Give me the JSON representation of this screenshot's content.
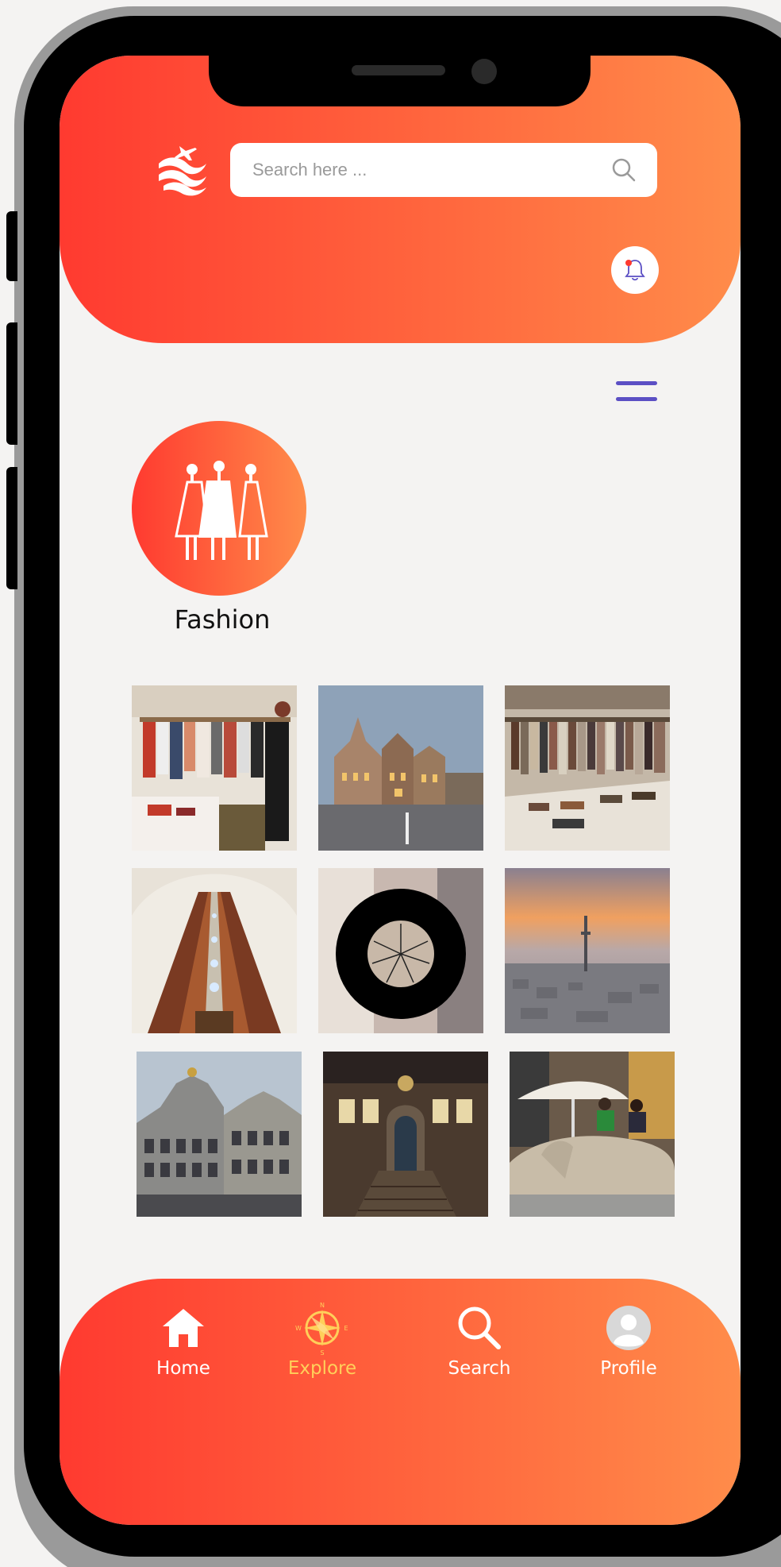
{
  "app": {
    "brand_colors": {
      "gradient_start": "#ff3a30",
      "gradient_end": "#ff8c4a",
      "accent_purple": "#5b4fc4",
      "active_nav": "#ffcf5a"
    }
  },
  "header": {
    "logo_icon": "wave-airplane-logo-icon",
    "search": {
      "placeholder": "Search here ...",
      "value": "",
      "icon": "search-icon"
    },
    "notification_icon": "bell-icon"
  },
  "menu_icon": "hamburger-menu-icon",
  "category": {
    "icon": "mannequins-icon",
    "label": "Fashion"
  },
  "gallery": {
    "items": [
      {
        "subject": "clothing-store-interior"
      },
      {
        "subject": "gothic-building-square"
      },
      {
        "subject": "clothing-racks-shop"
      },
      {
        "subject": "escalator-tunnel"
      },
      {
        "subject": "fabric-closeup-with-loader"
      },
      {
        "subject": "city-sunset-tower"
      },
      {
        "subject": "guild-houses-facade"
      },
      {
        "subject": "station-hall-interior"
      },
      {
        "subject": "hand-sculpture-people"
      }
    ]
  },
  "bottom_nav": {
    "items": [
      {
        "label": "Home",
        "icon": "home-icon",
        "active": false
      },
      {
        "label": "Explore",
        "icon": "compass-icon",
        "active": true
      },
      {
        "label": "Search",
        "icon": "search-icon",
        "active": false
      },
      {
        "label": "Profile",
        "icon": "avatar-icon",
        "active": false
      }
    ]
  }
}
